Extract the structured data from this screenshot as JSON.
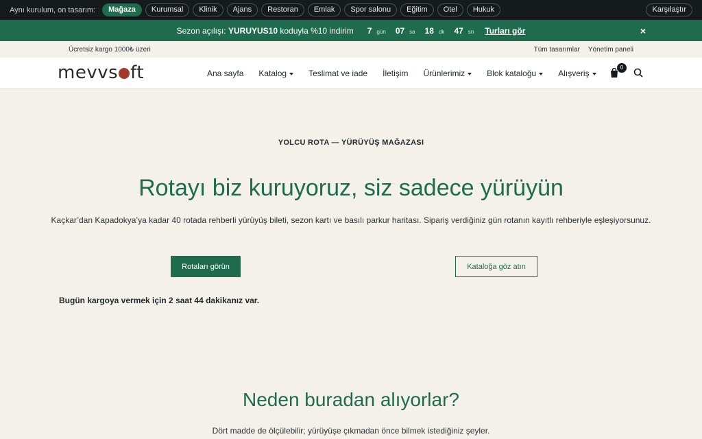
{
  "demobar": {
    "label": "Aynı kurulum, on tasarım:",
    "chips": [
      {
        "label": "Mağaza",
        "active": true
      },
      {
        "label": "Kurumsal",
        "active": false
      },
      {
        "label": "Klinik",
        "active": false
      },
      {
        "label": "Ajans",
        "active": false
      },
      {
        "label": "Restoran",
        "active": false
      },
      {
        "label": "Emlak",
        "active": false
      },
      {
        "label": "Spor salonu",
        "active": false
      },
      {
        "label": "Eğitim",
        "active": false
      },
      {
        "label": "Otel",
        "active": false
      },
      {
        "label": "Hukuk",
        "active": false
      }
    ],
    "compare": "Karşılaştır"
  },
  "promo": {
    "prefix": "Sezon açılışı:",
    "code": "YURUYUS10",
    "suffix": "koduyla %10 indirim",
    "countdown": [
      {
        "value": "7",
        "unit": "gün"
      },
      {
        "value": "07",
        "unit": "sa"
      },
      {
        "value": "18",
        "unit": "dk"
      },
      {
        "value": "47",
        "unit": "sn"
      }
    ],
    "cta": "Turları gör",
    "close": "×"
  },
  "util": {
    "shipping": "Ücretsiz kargo 1000₺ üzeri",
    "links": [
      "Tüm tasarımlar",
      "Yönetim paneli"
    ]
  },
  "header": {
    "logo_pre": "mevvs",
    "logo_post": "ft",
    "nav": [
      {
        "label": "Ana sayfa",
        "dropdown": false
      },
      {
        "label": "Katalog",
        "dropdown": true
      },
      {
        "label": "Teslimat ve iade",
        "dropdown": false
      },
      {
        "label": "İletişim",
        "dropdown": false
      },
      {
        "label": "Ürünlerimiz",
        "dropdown": true
      },
      {
        "label": "Blok kataloğu",
        "dropdown": true
      },
      {
        "label": "Alışveriş",
        "dropdown": true
      }
    ],
    "cart_count": "0"
  },
  "hero": {
    "eyebrow": "YOLCU ROTA — YÜRÜYÜŞ MAĞAZASI",
    "title": "Rotayı biz kuruyoruz, siz sadece yürüyün",
    "subtitle": "Kaçkar’dan Kapadokya’ya kadar 40 rotada rehberli yürüyüş bileti, sezon kartı ve basılı parkur haritası. Sipariş verdiğiniz gün rotanın kayıtlı rehberiyle eşleşiyorsunuz.",
    "primary_btn": "Rotaları görün",
    "secondary_btn": "Kataloğa göz atın",
    "shipping_note": "Bugün kargoya vermek için 2 saat 44 dakikanız var."
  },
  "why": {
    "title": "Neden buradan alıyorlar?",
    "subtitle": "Dört madde de ölçülebilir; yürüyüşe çıkmadan önce bilmek istediğiniz şeyler."
  },
  "colors": {
    "brand": "#1e6b4e",
    "dark": "#151b1d",
    "bg": "#f4f1ea",
    "logo_dot": "#a2392a"
  }
}
